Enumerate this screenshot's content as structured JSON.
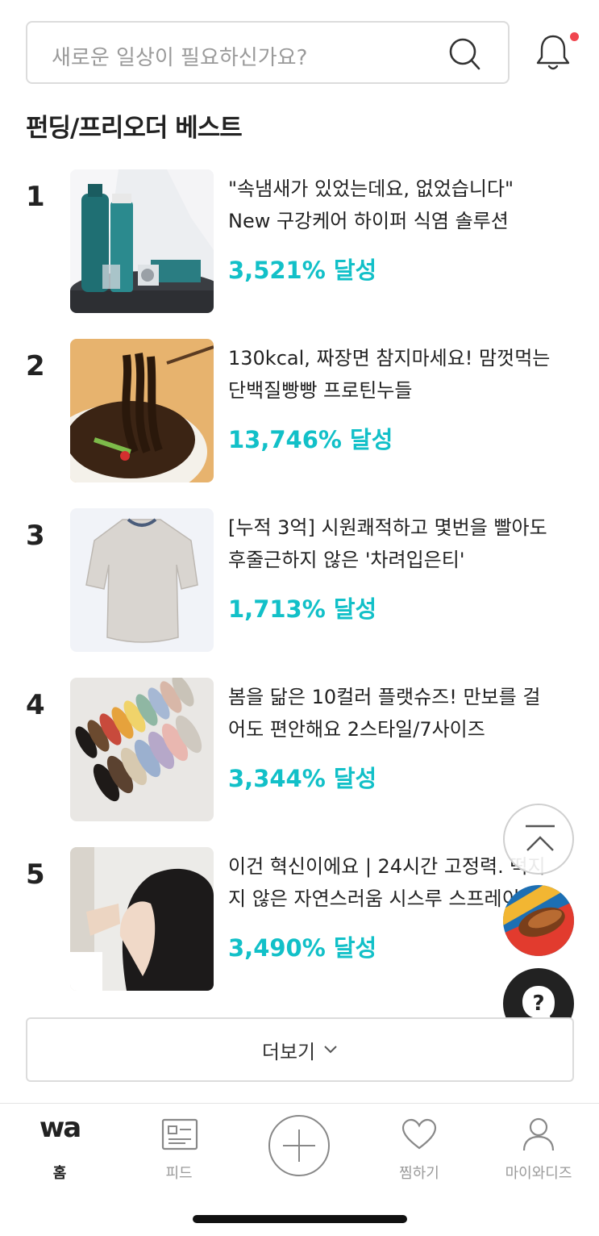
{
  "search": {
    "placeholder": "새로운 일상이 필요하신가요?"
  },
  "section": {
    "title": "펀딩/프리오더 베스트"
  },
  "items": [
    {
      "rank": "1",
      "title_line1": "\"속냄새가 있었는데요, 없었습니다\"",
      "title_line2": "New 구강케어 하이퍼 식염 솔루션",
      "rate": "3,521% 달성"
    },
    {
      "rank": "2",
      "title_line1": "130kcal, 짜장면 참지마세요! 맘껏먹는",
      "title_line2": "단백질빵빵 프로틴누들",
      "rate": "13,746% 달성"
    },
    {
      "rank": "3",
      "title_line1": "[누적 3억] 시원쾌적하고 몇번을 빨아도",
      "title_line2": "후줄근하지 않은 '차려입은티'",
      "rate": "1,713% 달성"
    },
    {
      "rank": "4",
      "title_line1": "봄을 닮은 10컬러 플랫슈즈! 만보를 걸",
      "title_line2": "어도 편안해요 2스타일/7사이즈",
      "rate": "3,344% 달성"
    },
    {
      "rank": "5",
      "title_line1": "이건 혁신이에요 | 24시간 고정력. 떡지",
      "title_line2": "지 않은 자연스러움 시스루 스프레이",
      "rate": "3,490% 달성"
    }
  ],
  "more": {
    "label": "더보기"
  },
  "tabs": [
    {
      "label": "홈",
      "icon": "wadiz-logo-icon",
      "logo_text": "wa"
    },
    {
      "label": "피드",
      "icon": "feed-icon"
    },
    {
      "label": "",
      "icon": "plus-icon"
    },
    {
      "label": "찜하기",
      "icon": "heart-icon"
    },
    {
      "label": "마이와디즈",
      "icon": "person-icon"
    }
  ],
  "colors": {
    "accent": "#12c0c8",
    "notification_dot": "#f0454f"
  }
}
